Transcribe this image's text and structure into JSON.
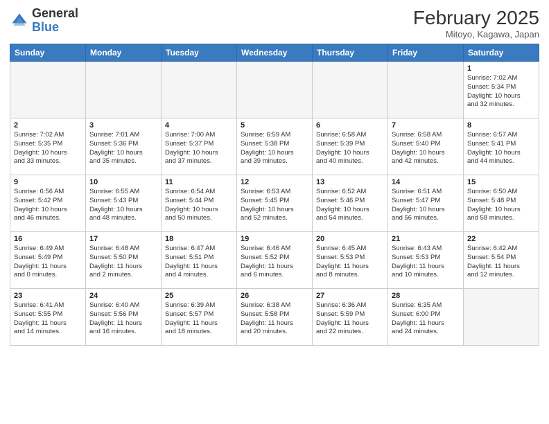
{
  "header": {
    "logo": {
      "general": "General",
      "blue": "Blue"
    },
    "title": "February 2025",
    "location": "Mitoyo, Kagawa, Japan"
  },
  "weekdays": [
    "Sunday",
    "Monday",
    "Tuesday",
    "Wednesday",
    "Thursday",
    "Friday",
    "Saturday"
  ],
  "weeks": [
    [
      {
        "day": "",
        "info": ""
      },
      {
        "day": "",
        "info": ""
      },
      {
        "day": "",
        "info": ""
      },
      {
        "day": "",
        "info": ""
      },
      {
        "day": "",
        "info": ""
      },
      {
        "day": "",
        "info": ""
      },
      {
        "day": "1",
        "info": "Sunrise: 7:02 AM\nSunset: 5:34 PM\nDaylight: 10 hours\nand 32 minutes."
      }
    ],
    [
      {
        "day": "2",
        "info": "Sunrise: 7:02 AM\nSunset: 5:35 PM\nDaylight: 10 hours\nand 33 minutes."
      },
      {
        "day": "3",
        "info": "Sunrise: 7:01 AM\nSunset: 5:36 PM\nDaylight: 10 hours\nand 35 minutes."
      },
      {
        "day": "4",
        "info": "Sunrise: 7:00 AM\nSunset: 5:37 PM\nDaylight: 10 hours\nand 37 minutes."
      },
      {
        "day": "5",
        "info": "Sunrise: 6:59 AM\nSunset: 5:38 PM\nDaylight: 10 hours\nand 39 minutes."
      },
      {
        "day": "6",
        "info": "Sunrise: 6:58 AM\nSunset: 5:39 PM\nDaylight: 10 hours\nand 40 minutes."
      },
      {
        "day": "7",
        "info": "Sunrise: 6:58 AM\nSunset: 5:40 PM\nDaylight: 10 hours\nand 42 minutes."
      },
      {
        "day": "8",
        "info": "Sunrise: 6:57 AM\nSunset: 5:41 PM\nDaylight: 10 hours\nand 44 minutes."
      }
    ],
    [
      {
        "day": "9",
        "info": "Sunrise: 6:56 AM\nSunset: 5:42 PM\nDaylight: 10 hours\nand 46 minutes."
      },
      {
        "day": "10",
        "info": "Sunrise: 6:55 AM\nSunset: 5:43 PM\nDaylight: 10 hours\nand 48 minutes."
      },
      {
        "day": "11",
        "info": "Sunrise: 6:54 AM\nSunset: 5:44 PM\nDaylight: 10 hours\nand 50 minutes."
      },
      {
        "day": "12",
        "info": "Sunrise: 6:53 AM\nSunset: 5:45 PM\nDaylight: 10 hours\nand 52 minutes."
      },
      {
        "day": "13",
        "info": "Sunrise: 6:52 AM\nSunset: 5:46 PM\nDaylight: 10 hours\nand 54 minutes."
      },
      {
        "day": "14",
        "info": "Sunrise: 6:51 AM\nSunset: 5:47 PM\nDaylight: 10 hours\nand 56 minutes."
      },
      {
        "day": "15",
        "info": "Sunrise: 6:50 AM\nSunset: 5:48 PM\nDaylight: 10 hours\nand 58 minutes."
      }
    ],
    [
      {
        "day": "16",
        "info": "Sunrise: 6:49 AM\nSunset: 5:49 PM\nDaylight: 11 hours\nand 0 minutes."
      },
      {
        "day": "17",
        "info": "Sunrise: 6:48 AM\nSunset: 5:50 PM\nDaylight: 11 hours\nand 2 minutes."
      },
      {
        "day": "18",
        "info": "Sunrise: 6:47 AM\nSunset: 5:51 PM\nDaylight: 11 hours\nand 4 minutes."
      },
      {
        "day": "19",
        "info": "Sunrise: 6:46 AM\nSunset: 5:52 PM\nDaylight: 11 hours\nand 6 minutes."
      },
      {
        "day": "20",
        "info": "Sunrise: 6:45 AM\nSunset: 5:53 PM\nDaylight: 11 hours\nand 8 minutes."
      },
      {
        "day": "21",
        "info": "Sunrise: 6:43 AM\nSunset: 5:53 PM\nDaylight: 11 hours\nand 10 minutes."
      },
      {
        "day": "22",
        "info": "Sunrise: 6:42 AM\nSunset: 5:54 PM\nDaylight: 11 hours\nand 12 minutes."
      }
    ],
    [
      {
        "day": "23",
        "info": "Sunrise: 6:41 AM\nSunset: 5:55 PM\nDaylight: 11 hours\nand 14 minutes."
      },
      {
        "day": "24",
        "info": "Sunrise: 6:40 AM\nSunset: 5:56 PM\nDaylight: 11 hours\nand 16 minutes."
      },
      {
        "day": "25",
        "info": "Sunrise: 6:39 AM\nSunset: 5:57 PM\nDaylight: 11 hours\nand 18 minutes."
      },
      {
        "day": "26",
        "info": "Sunrise: 6:38 AM\nSunset: 5:58 PM\nDaylight: 11 hours\nand 20 minutes."
      },
      {
        "day": "27",
        "info": "Sunrise: 6:36 AM\nSunset: 5:59 PM\nDaylight: 11 hours\nand 22 minutes."
      },
      {
        "day": "28",
        "info": "Sunrise: 6:35 AM\nSunset: 6:00 PM\nDaylight: 11 hours\nand 24 minutes."
      },
      {
        "day": "",
        "info": ""
      }
    ]
  ]
}
